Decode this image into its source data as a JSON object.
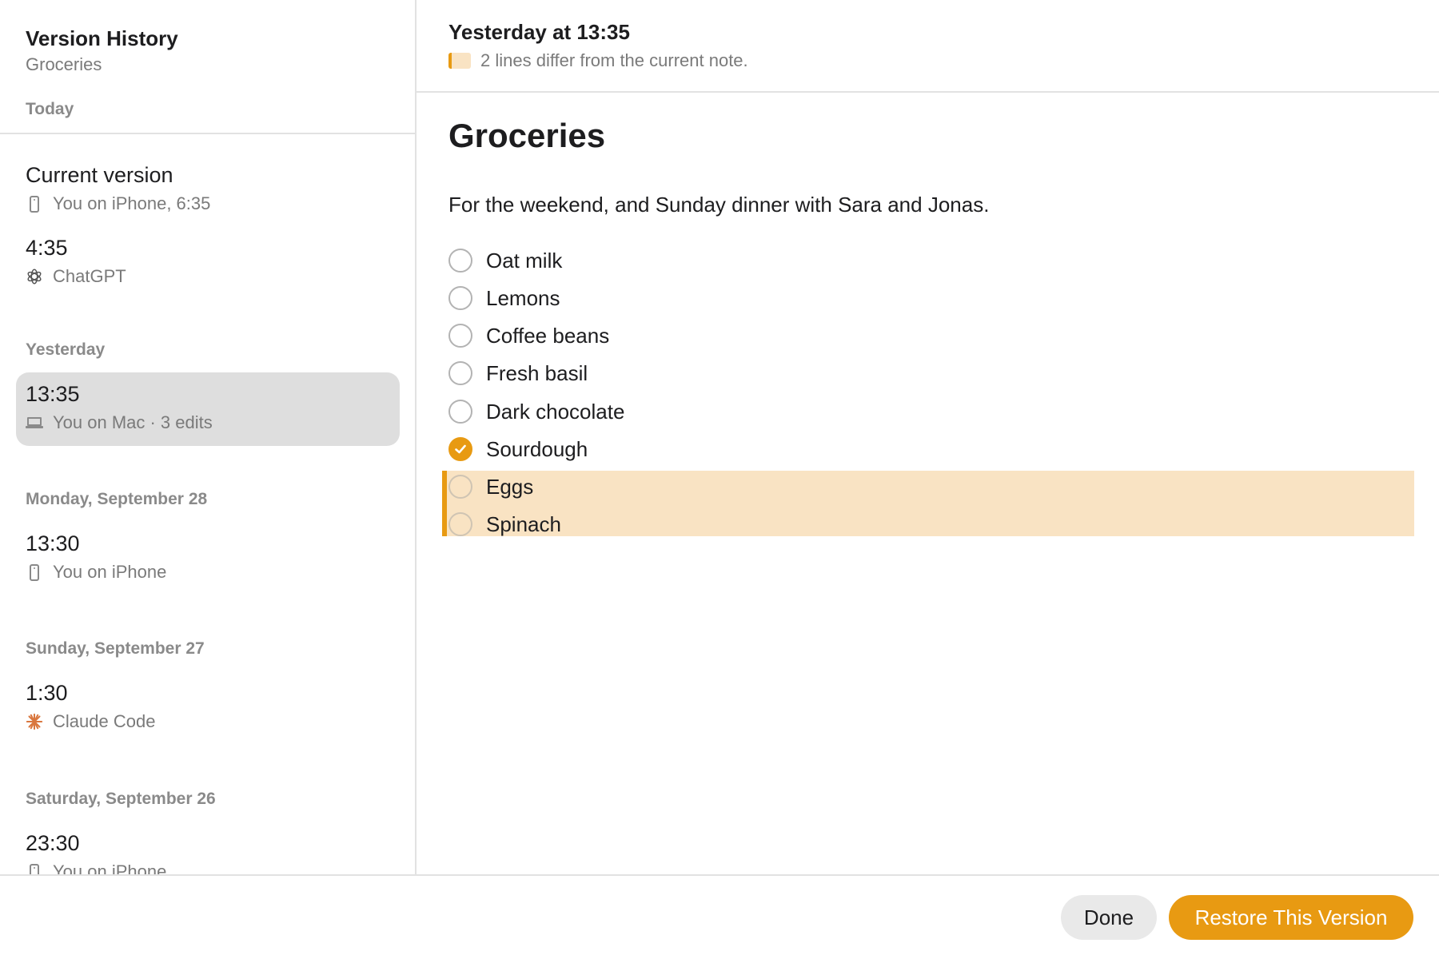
{
  "sidebar": {
    "title": "Version History",
    "subtitle": "Groceries",
    "sections": {
      "today": "Today",
      "yesterday": "Yesterday",
      "sep28": "Monday, September 28",
      "sep27": "Sunday, September 27",
      "sep26": "Saturday, September 26"
    },
    "versions": [
      {
        "time": "Current version",
        "meta": "You on iPhone, 6:35",
        "icon": "iphone-icon"
      },
      {
        "time": "4:35",
        "meta": "ChatGPT",
        "icon": "chatgpt-icon"
      },
      {
        "time": "13:35",
        "meta": "You on Mac · 3 edits",
        "icon": "laptop-icon",
        "selected": true
      },
      {
        "time": "13:30",
        "meta": "You on iPhone",
        "icon": "iphone-icon"
      },
      {
        "time": "1:30",
        "meta": "Claude Code",
        "icon": "claude-icon"
      },
      {
        "time": "23:30",
        "meta": "You on iPhone",
        "icon": "iphone-icon"
      }
    ]
  },
  "main": {
    "header_title": "Yesterday at 13:35",
    "header_sub": "2 lines differ from the current note.",
    "note_title": "Groceries",
    "note_body": "For the weekend, and Sunday dinner with Sara and Jonas.",
    "items": [
      {
        "label": "Oat milk",
        "checked": false
      },
      {
        "label": "Lemons",
        "checked": false
      },
      {
        "label": "Coffee beans",
        "checked": false
      },
      {
        "label": "Fresh basil",
        "checked": false
      },
      {
        "label": "Dark chocolate",
        "checked": false
      },
      {
        "label": "Sourdough",
        "checked": true
      },
      {
        "label": "Eggs",
        "checked": false,
        "changed": true
      },
      {
        "label": "Spinach",
        "checked": false,
        "changed": true
      }
    ]
  },
  "footer": {
    "done_label": "Done",
    "restore_label": "Restore This Version"
  },
  "colors": {
    "accent": "#e89a12",
    "diff_highlight": "#f9e3c3",
    "selected_row": "#dedede",
    "claude": "#d9773f"
  }
}
